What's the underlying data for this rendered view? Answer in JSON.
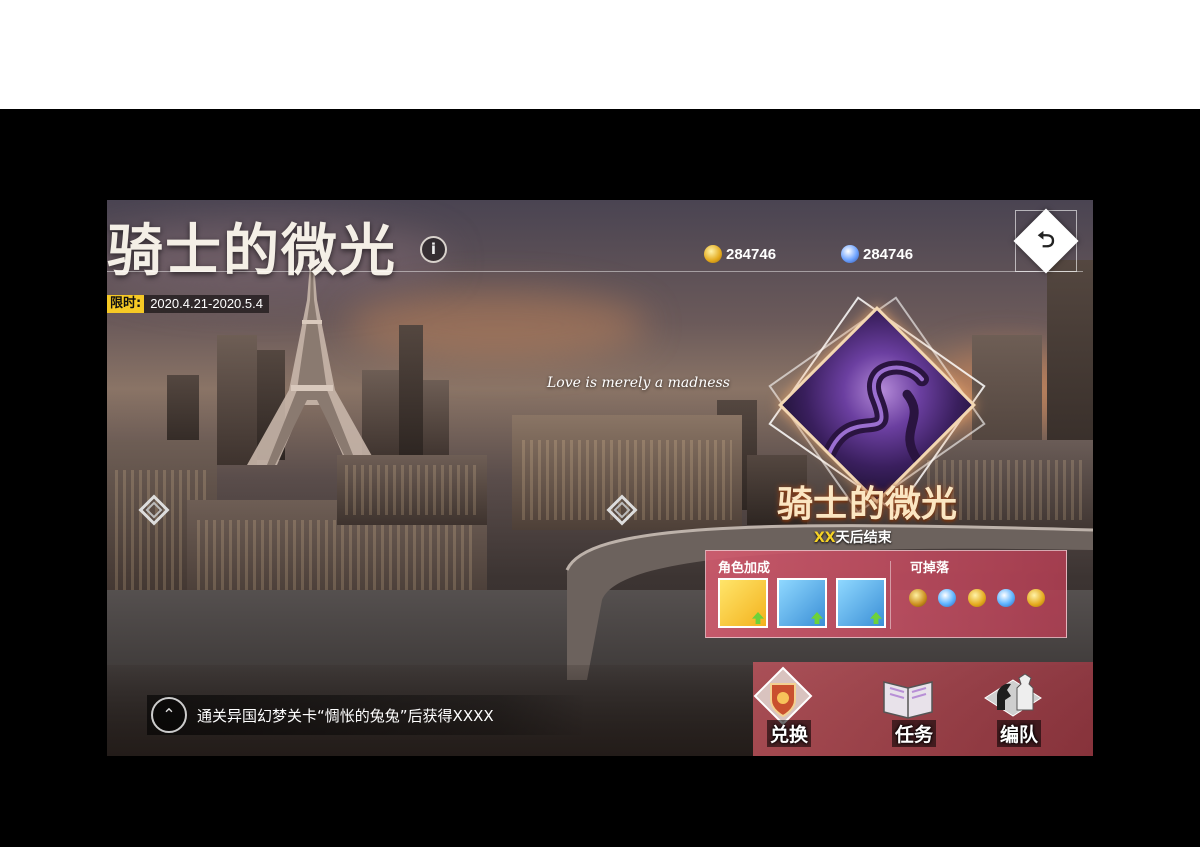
{
  "title": "骑士的微光",
  "info_icon": "i",
  "currency": [
    {
      "icon": "gold-coin-icon",
      "amount": "284746"
    },
    {
      "icon": "diamond-icon",
      "amount": "284746"
    }
  ],
  "back_icon": "undo-arrow-icon",
  "limit": {
    "tag": "限时:",
    "range": "2020.4.21-2020.5.4"
  },
  "tagline": "Love is merely a madness",
  "event": {
    "title": "骑士的微光",
    "ends_highlight": "XX",
    "ends_suffix": "天后结束"
  },
  "panel": {
    "bonus_label": "角色加成",
    "drops_label": "可掉落",
    "bonus_slots": [
      "yellow",
      "blue",
      "blue"
    ],
    "drops": [
      "gold-pouch",
      "diamond",
      "gold-coin",
      "diamond",
      "gold-coin"
    ]
  },
  "menu": [
    {
      "name": "exchange",
      "label": "兑换"
    },
    {
      "name": "tasks",
      "label": "任务"
    },
    {
      "name": "team",
      "label": "编队"
    }
  ],
  "hint": {
    "text": "通关异国幻梦关卡“惆怅的兔兔”后获得XXXX"
  },
  "colors": {
    "accent_gold": "#f6c925",
    "panel_pink": "#d65c70"
  }
}
